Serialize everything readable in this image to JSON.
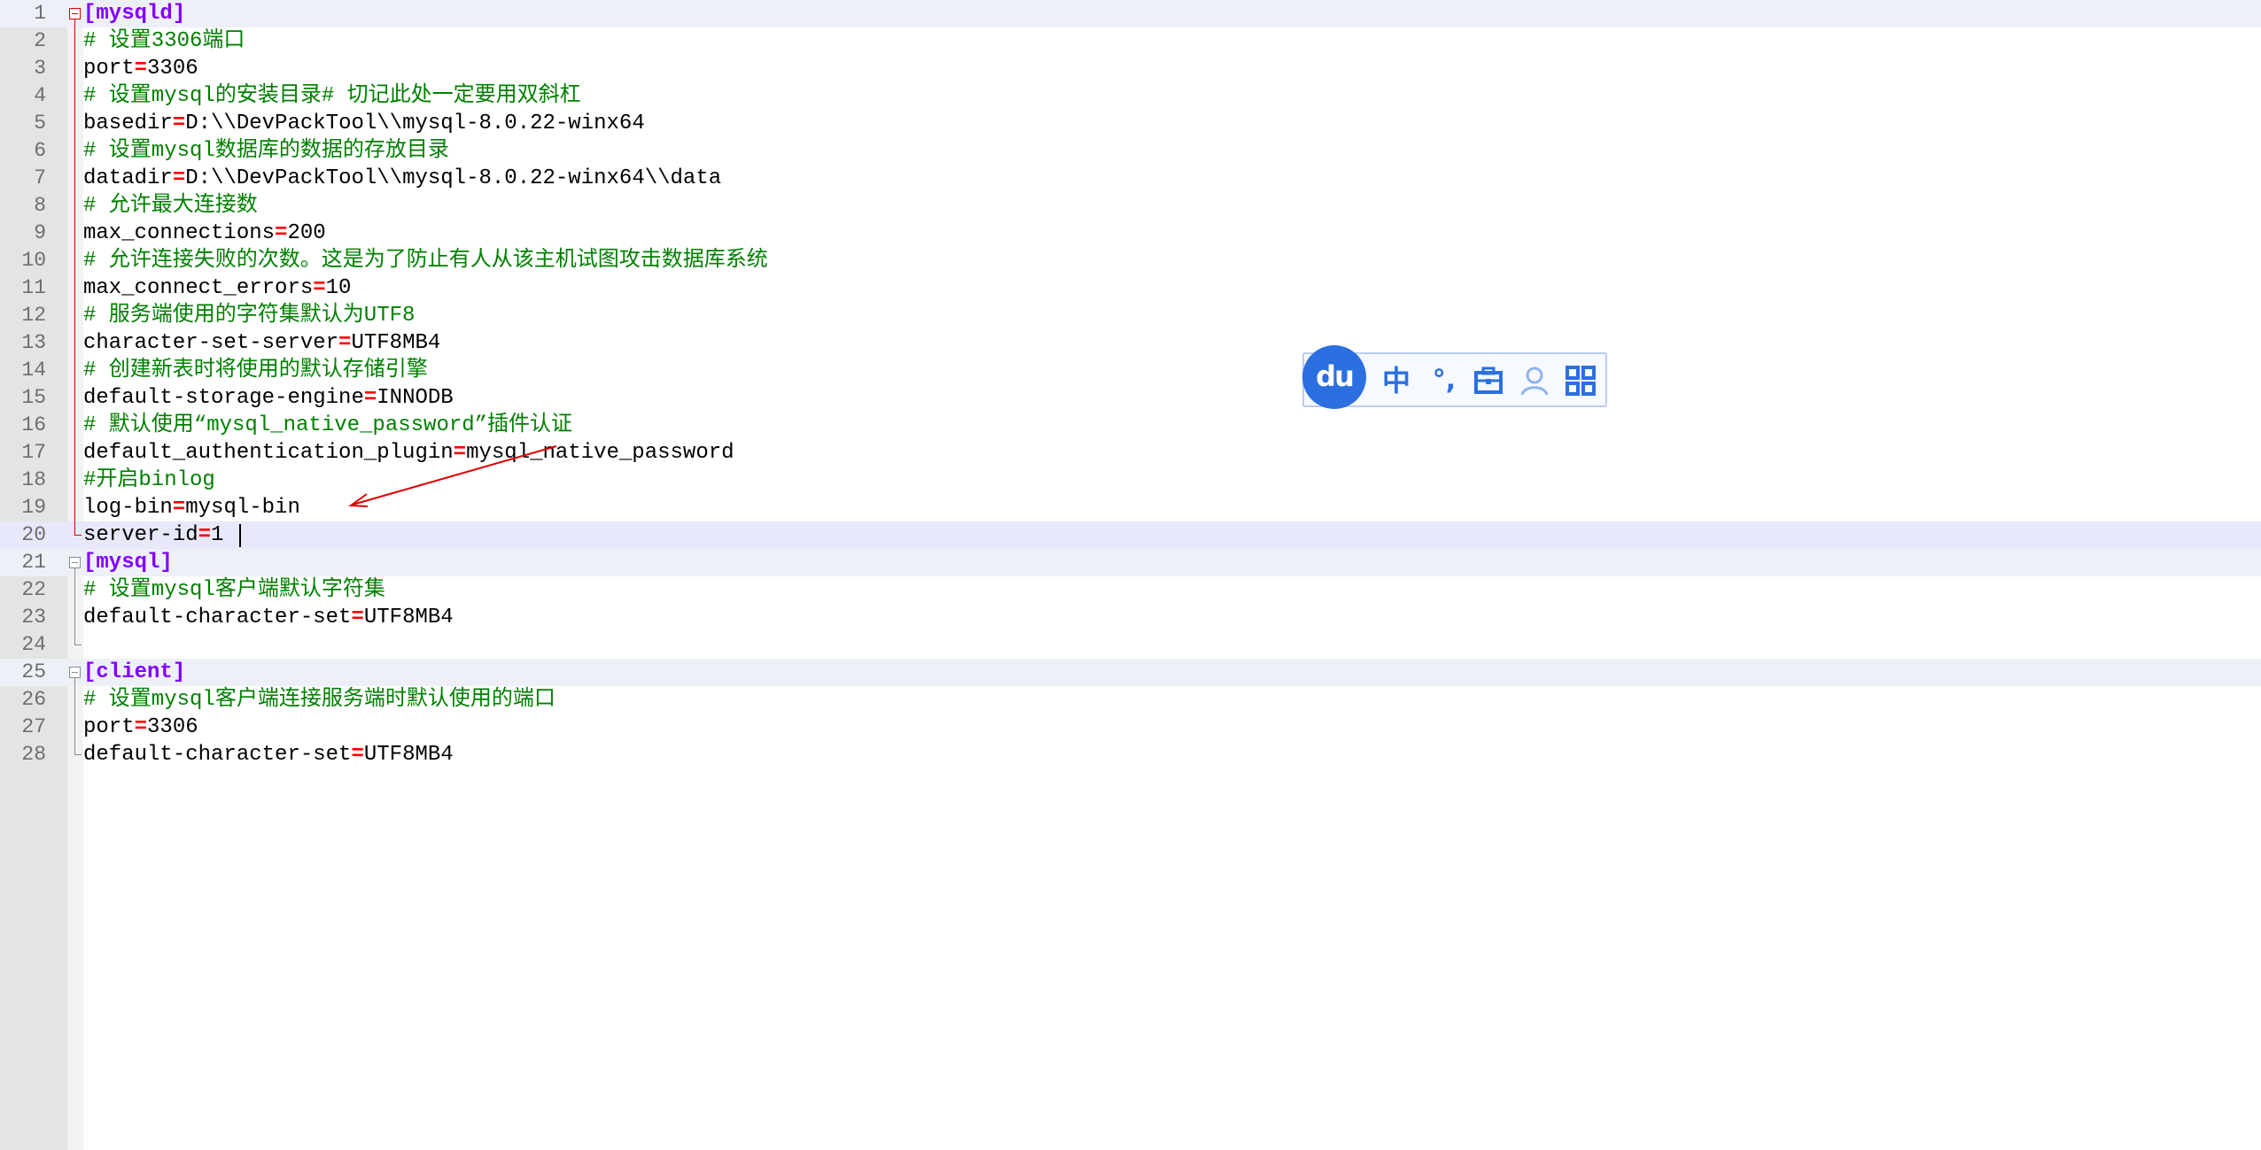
{
  "editor": {
    "lines": [
      {
        "n": "1",
        "segs": [
          {
            "t": "[mysqld]",
            "c": "section"
          }
        ]
      },
      {
        "n": "2",
        "segs": [
          {
            "t": "# 设置3306端口",
            "c": "comment"
          }
        ]
      },
      {
        "n": "3",
        "segs": [
          {
            "t": "port",
            "c": "key"
          },
          {
            "t": "=",
            "c": "eq"
          },
          {
            "t": "3306",
            "c": "val"
          }
        ]
      },
      {
        "n": "4",
        "segs": [
          {
            "t": "# 设置mysql的安装目录# 切记此处一定要用双斜杠",
            "c": "comment"
          }
        ]
      },
      {
        "n": "5",
        "segs": [
          {
            "t": "basedir",
            "c": "key"
          },
          {
            "t": "=",
            "c": "eq"
          },
          {
            "t": "D:\\\\DevPackTool\\\\mysql-8.0.22-winx64",
            "c": "val"
          }
        ]
      },
      {
        "n": "6",
        "segs": [
          {
            "t": "# 设置mysql数据库的数据的存放目录",
            "c": "comment"
          }
        ]
      },
      {
        "n": "7",
        "segs": [
          {
            "t": "datadir",
            "c": "key"
          },
          {
            "t": "=",
            "c": "eq"
          },
          {
            "t": "D:\\\\DevPackTool\\\\mysql-8.0.22-winx64\\\\data",
            "c": "val"
          }
        ]
      },
      {
        "n": "8",
        "segs": [
          {
            "t": "# 允许最大连接数",
            "c": "comment"
          }
        ]
      },
      {
        "n": "9",
        "segs": [
          {
            "t": "max_connections",
            "c": "key"
          },
          {
            "t": "=",
            "c": "eq"
          },
          {
            "t": "200",
            "c": "val"
          }
        ]
      },
      {
        "n": "10",
        "segs": [
          {
            "t": "# 允许连接失败的次数。这是为了防止有人从该主机试图攻击数据库系统",
            "c": "comment"
          }
        ]
      },
      {
        "n": "11",
        "segs": [
          {
            "t": "max_connect_errors",
            "c": "key"
          },
          {
            "t": "=",
            "c": "eq"
          },
          {
            "t": "10",
            "c": "val"
          }
        ]
      },
      {
        "n": "12",
        "segs": [
          {
            "t": "# 服务端使用的字符集默认为UTF8",
            "c": "comment"
          }
        ]
      },
      {
        "n": "13",
        "segs": [
          {
            "t": "character-set-server",
            "c": "key"
          },
          {
            "t": "=",
            "c": "eq"
          },
          {
            "t": "UTF8MB4",
            "c": "val"
          }
        ]
      },
      {
        "n": "14",
        "segs": [
          {
            "t": "# 创建新表时将使用的默认存储引擎",
            "c": "comment"
          }
        ]
      },
      {
        "n": "15",
        "segs": [
          {
            "t": "default-storage-engine",
            "c": "key"
          },
          {
            "t": "=",
            "c": "eq"
          },
          {
            "t": "INNODB",
            "c": "val"
          }
        ]
      },
      {
        "n": "16",
        "segs": [
          {
            "t": "# 默认使用“mysql_native_password”插件认证",
            "c": "comment"
          }
        ]
      },
      {
        "n": "17",
        "segs": [
          {
            "t": "default_authentication_plugin",
            "c": "key"
          },
          {
            "t": "=",
            "c": "eq"
          },
          {
            "t": "mysql_native_password",
            "c": "val"
          }
        ]
      },
      {
        "n": "18",
        "segs": [
          {
            "t": "#开启binlog",
            "c": "comment"
          }
        ]
      },
      {
        "n": "19",
        "segs": [
          {
            "t": "log-bin",
            "c": "key"
          },
          {
            "t": "=",
            "c": "eq"
          },
          {
            "t": "mysql-bin",
            "c": "val"
          }
        ]
      },
      {
        "n": "20",
        "segs": [
          {
            "t": "server-id",
            "c": "key"
          },
          {
            "t": "=",
            "c": "eq"
          },
          {
            "t": "1",
            "c": "val"
          }
        ]
      },
      {
        "n": "21",
        "segs": [
          {
            "t": "[mysql]",
            "c": "section"
          }
        ]
      },
      {
        "n": "22",
        "segs": [
          {
            "t": "# 设置mysql客户端默认字符集",
            "c": "comment"
          }
        ]
      },
      {
        "n": "23",
        "segs": [
          {
            "t": "default-character-set",
            "c": "key"
          },
          {
            "t": "=",
            "c": "eq"
          },
          {
            "t": "UTF8MB4",
            "c": "val"
          }
        ]
      },
      {
        "n": "24",
        "segs": []
      },
      {
        "n": "25",
        "segs": [
          {
            "t": "[client]",
            "c": "section"
          }
        ]
      },
      {
        "n": "26",
        "segs": [
          {
            "t": "# 设置mysql客户端连接服务端时默认使用的端口",
            "c": "comment"
          }
        ]
      },
      {
        "n": "27",
        "segs": [
          {
            "t": "port",
            "c": "key"
          },
          {
            "t": "=",
            "c": "eq"
          },
          {
            "t": "3306",
            "c": "val"
          }
        ]
      },
      {
        "n": "28",
        "segs": [
          {
            "t": "default-character-set",
            "c": "key"
          },
          {
            "t": "=",
            "c": "eq"
          },
          {
            "t": "UTF8MB4",
            "c": "val"
          }
        ]
      }
    ]
  },
  "ime_toolbar": {
    "logo_text": "du",
    "mode_label": "中",
    "punct_label": "°,",
    "toolbox_icon": "toolbox-icon",
    "user_icon": "user-icon",
    "grid_icon": "grid-icon"
  },
  "colors": {
    "section": "#8000ff",
    "comment": "#008000",
    "operator": "#ff0000",
    "accent": "#2b6fe0"
  }
}
